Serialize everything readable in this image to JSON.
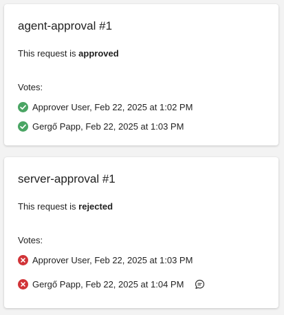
{
  "colors": {
    "approved_green": "#4aa564",
    "rejected_red": "#d13438",
    "card_bg": "#ffffff",
    "page_bg": "#f3f3f3"
  },
  "requests": [
    {
      "title": "agent-approval #1",
      "status_prefix": "This request is ",
      "status": "approved",
      "votes_label": "Votes:",
      "votes": [
        {
          "icon": "check-circle-icon",
          "text": "Approver User, Feb 22, 2025 at 1:02 PM"
        },
        {
          "icon": "check-circle-icon",
          "text": "Gergő Papp, Feb 22, 2025 at 1:03 PM"
        }
      ]
    },
    {
      "title": "server-approval #1",
      "status_prefix": "This request is ",
      "status": "rejected",
      "votes_label": "Votes:",
      "votes": [
        {
          "icon": "x-circle-icon",
          "text": "Approver User, Feb 22, 2025 at 1:03 PM"
        },
        {
          "icon": "x-circle-icon",
          "text": "Gergő Papp, Feb 22, 2025 at 1:04 PM",
          "has_comment": true,
          "comment_icon": "comment-icon"
        }
      ]
    }
  ]
}
